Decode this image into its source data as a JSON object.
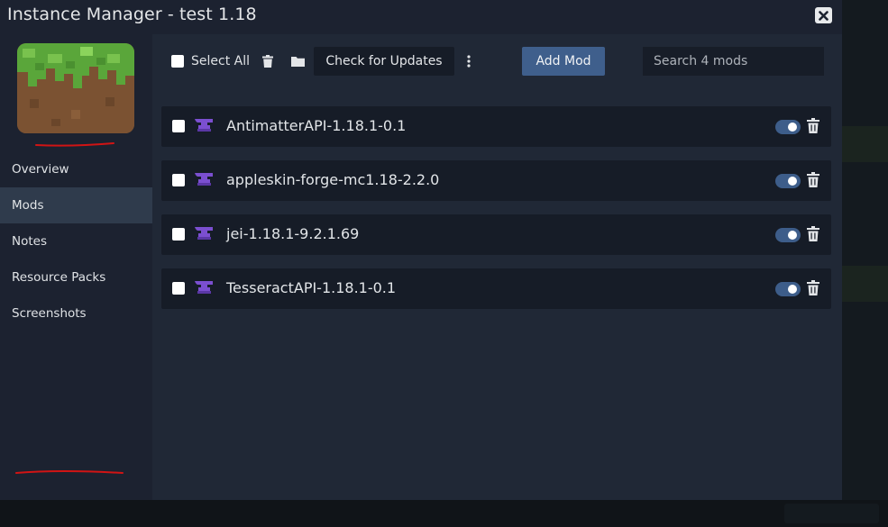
{
  "window": {
    "title": "Instance Manager - test 1.18"
  },
  "sidebar": {
    "items": [
      {
        "label": "Overview",
        "active": false
      },
      {
        "label": "Mods",
        "active": true
      },
      {
        "label": "Notes",
        "active": false
      },
      {
        "label": "Resource Packs",
        "active": false
      },
      {
        "label": "Screenshots",
        "active": false
      }
    ]
  },
  "toolbar": {
    "select_all_label": "Select All",
    "check_updates_label": "Check for Updates",
    "add_mod_label": "Add Mod",
    "search_placeholder": "Search 4 mods"
  },
  "mods": [
    {
      "name": "AntimatterAPI-1.18.1-0.1",
      "enabled": true
    },
    {
      "name": "appleskin-forge-mc1.18-2.2.0",
      "enabled": true
    },
    {
      "name": "jei-1.18.1-9.2.1.69",
      "enabled": true
    },
    {
      "name": "TesseractAPI-1.18.1-0.1",
      "enabled": true
    }
  ],
  "colors": {
    "accent": "#3f5f8c",
    "modal_bg": "#1c2230",
    "content_bg": "#202836",
    "row_bg": "#161c27",
    "anvil_icon": "#7b4fd0"
  }
}
